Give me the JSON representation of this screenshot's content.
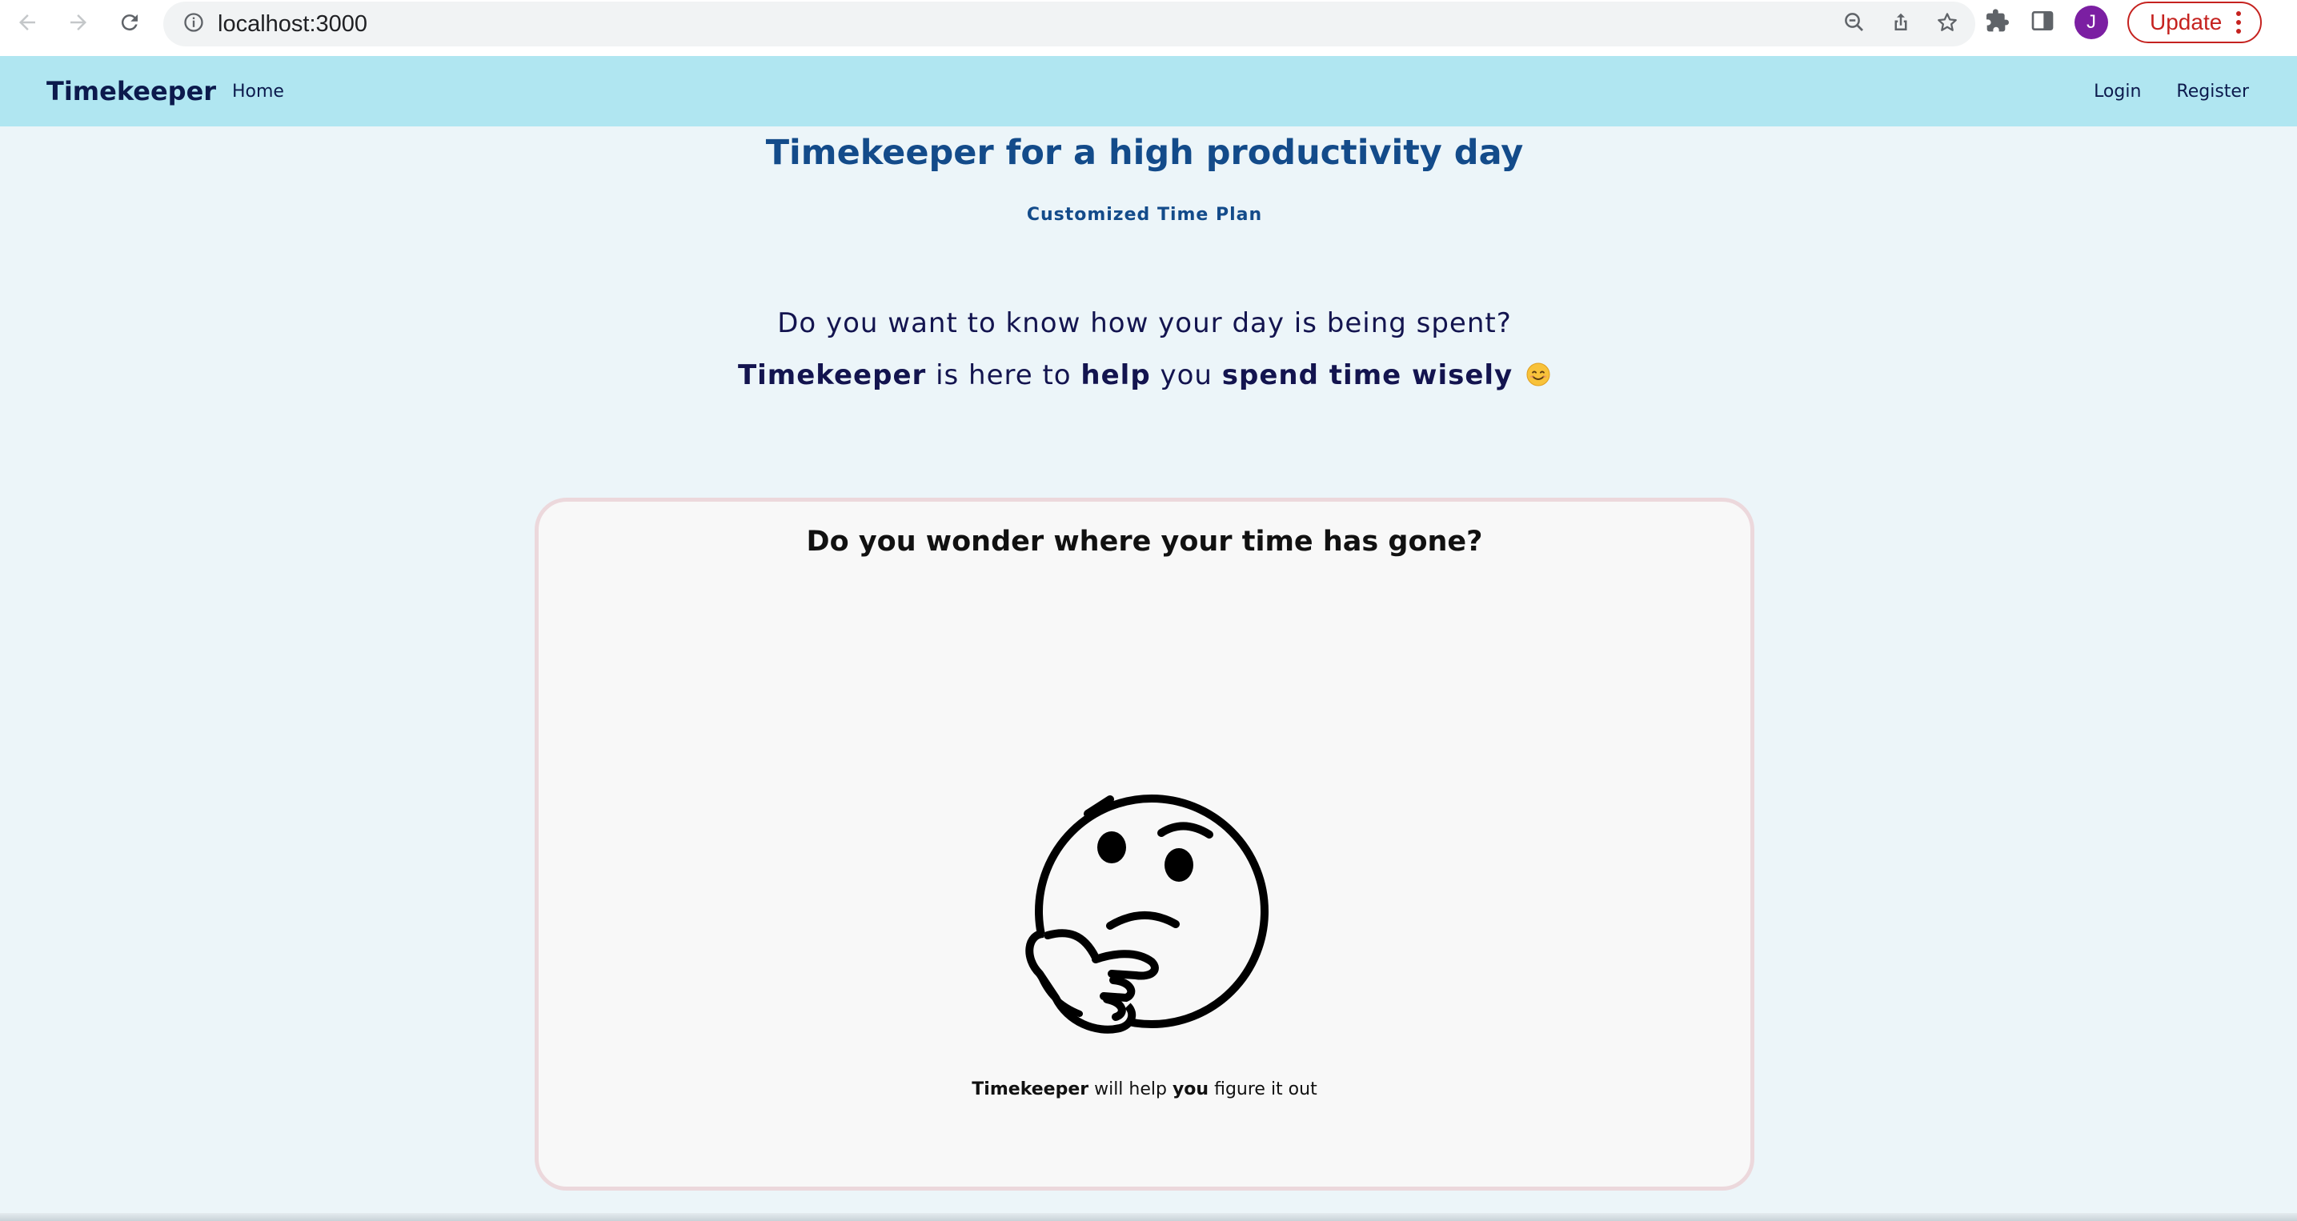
{
  "browser": {
    "url": "localhost:3000",
    "avatar_letter": "J",
    "update_label": "Update"
  },
  "navbar": {
    "brand": "Timekeeper",
    "home": "Home",
    "login": "Login",
    "register": "Register"
  },
  "hero": {
    "title": "Timekeeper for a high productivity day",
    "subtitle": "Customized Time Plan",
    "line1": "Do you want to know how your day is being spent?",
    "line2": {
      "part1": "Timekeeper",
      "part2": " is here to ",
      "part3": "help",
      "part4": " you ",
      "part5": "spend time wisely",
      "emoji": "😊"
    }
  },
  "card": {
    "title": "Do you wonder where your time has gone?",
    "caption": {
      "part1": "Timekeeper",
      "part2": " will help ",
      "part3": "you",
      "part4": " figure it out"
    }
  },
  "icons": {
    "back": "back-arrow-icon",
    "forward": "forward-arrow-icon",
    "reload": "reload-icon",
    "info": "info-icon",
    "zoom": "zoom-out-icon",
    "share": "share-icon",
    "star": "star-icon",
    "extensions": "puzzle-icon",
    "sidepanel": "side-panel-icon",
    "thinking": "thinking-face-icon"
  }
}
